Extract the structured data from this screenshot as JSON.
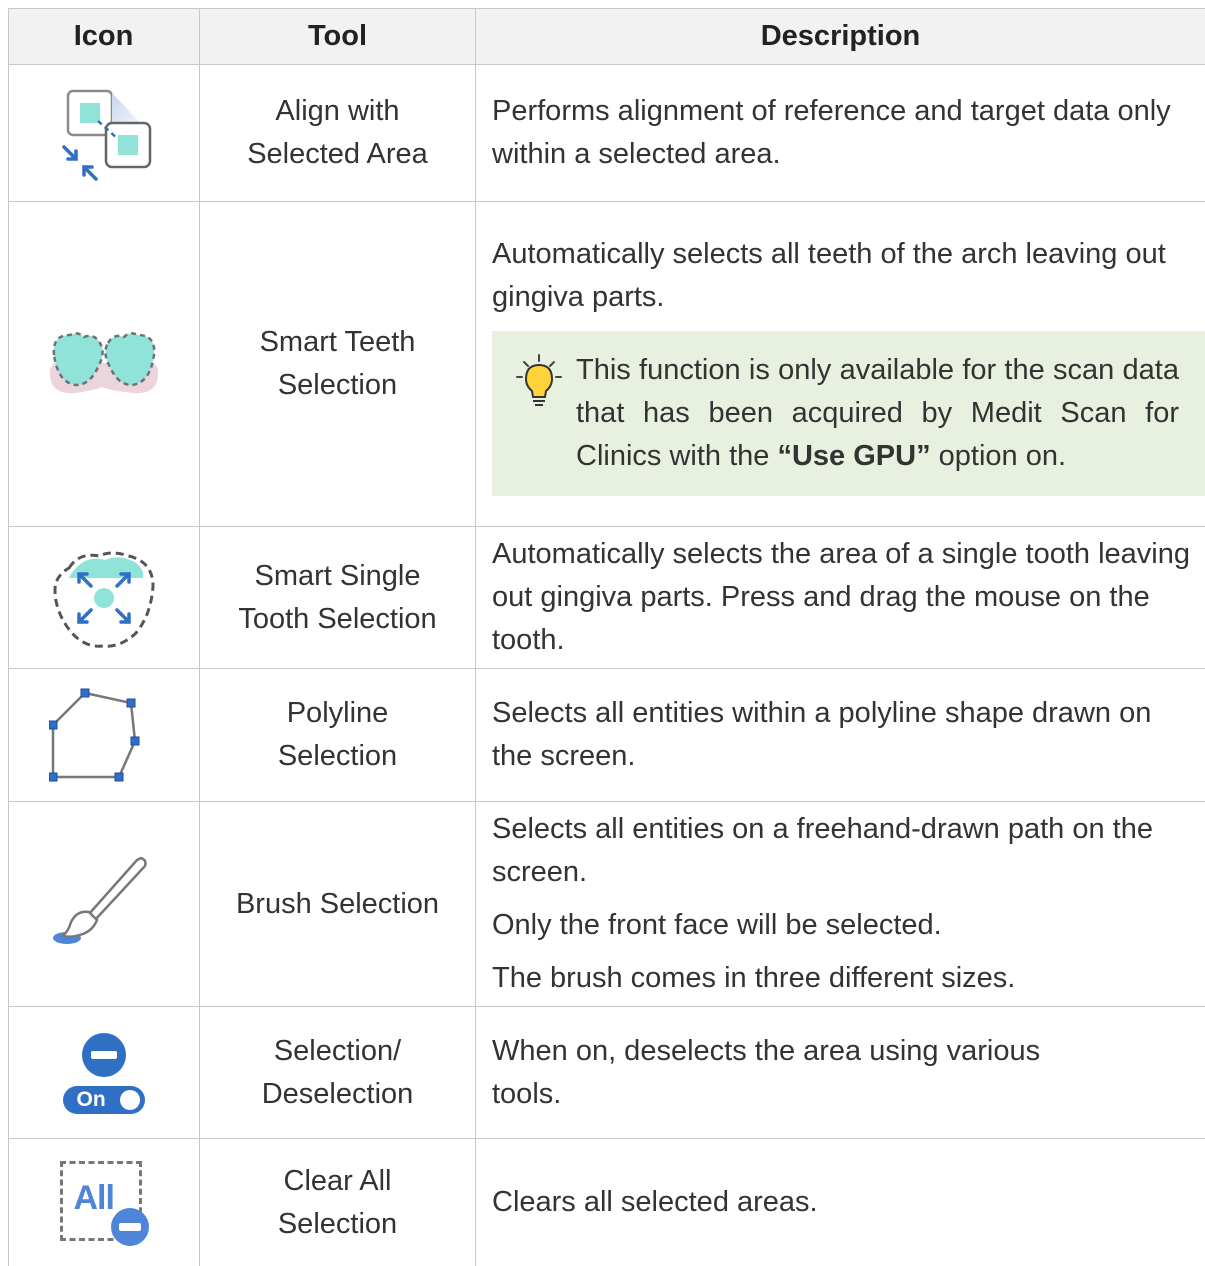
{
  "table": {
    "headers": {
      "icon": "Icon",
      "tool": "Tool",
      "description": "Description"
    },
    "rows": [
      {
        "icon": "align-selected-area-icon",
        "tool": [
          "Align with",
          "Selected Area"
        ],
        "description": [
          "Performs alignment of reference and target data only within a selected area."
        ]
      },
      {
        "icon": "smart-teeth-selection-icon",
        "tool": [
          "Smart Teeth",
          "Selection"
        ],
        "description": [
          "Automatically selects all teeth of the arch leaving out gingiva parts."
        ],
        "note": {
          "icon": "lightbulb-icon",
          "text_before": "This function is only available for the scan data that has been acquired by Medit Scan for Clinics with the ",
          "bold": "“Use GPU”",
          "text_after": " option on."
        }
      },
      {
        "icon": "smart-single-tooth-selection-icon",
        "tool": [
          "Smart Single",
          "Tooth Selection"
        ],
        "description": [
          "Automatically selects the area of a single tooth leaving out gingiva parts. Press and drag the mouse on the tooth."
        ]
      },
      {
        "icon": "polyline-selection-icon",
        "tool": [
          "Polyline",
          "Selection"
        ],
        "description": [
          "Selects all entities within a polyline shape drawn on the screen."
        ]
      },
      {
        "icon": "brush-selection-icon",
        "tool": [
          "Brush Selection"
        ],
        "description": [
          "Selects all entities on a freehand-drawn path on the screen.",
          "Only the front face will be selected.",
          "The brush comes in three different sizes."
        ]
      },
      {
        "icon": "deselection-toggle-icon",
        "icon_label": "On",
        "tool": [
          "Selection/",
          "Deselection"
        ],
        "description": [
          "When on, deselects the area using various tools."
        ]
      },
      {
        "icon": "clear-all-selection-icon",
        "icon_label": "All",
        "tool": [
          "Clear All",
          "Selection"
        ],
        "description": [
          "Clears all selected areas."
        ]
      }
    ]
  },
  "colors": {
    "header_bg": "#f2f2f2",
    "border": "#c8c8c8",
    "note_bg": "#e8f0df",
    "accent_blue": "#2f6fc4",
    "teal": "#8fe3d8"
  }
}
